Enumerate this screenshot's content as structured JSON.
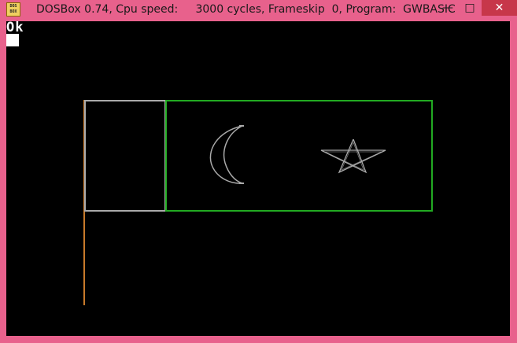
{
  "window": {
    "title": "DOSBox 0.74, Cpu speed:     3000 cycles, Frameskip  0, Program:  GWBASIC",
    "icon_label": "DOS\nBOX",
    "buttons": {
      "minimize": "—",
      "maximize": "□",
      "close": "✕"
    }
  },
  "console": {
    "prompt_text": "Ok"
  },
  "colors": {
    "title_bar": "#e8618c",
    "close_button": "#c7374a",
    "screen_bg": "#000000",
    "flagpole": "#c87a2a",
    "hoist_box": "#aaaaaa",
    "field_border": "#22aa22",
    "emblem": "#aaaaaa"
  },
  "icons": {
    "app": "dosbox-icon",
    "crescent": "crescent-icon",
    "star": "star-icon"
  }
}
